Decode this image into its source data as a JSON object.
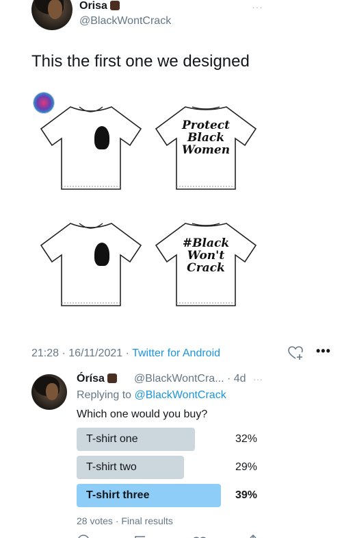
{
  "original_tweet": {
    "display_name": "Orisa",
    "handle": "@BlackWontCrack",
    "text": "This the first one we designed",
    "emoji_icon": "raised-fist-dark-skin",
    "more_glyph": "···"
  },
  "media": {
    "shirts": [
      {
        "view": "front",
        "print": "silhouette-woman"
      },
      {
        "view": "back",
        "caption_lines": [
          "Protect",
          "Black",
          "Women"
        ]
      },
      {
        "view": "front",
        "print": "silhouette-woman"
      },
      {
        "view": "back",
        "caption_lines": [
          "#Black",
          "Won't",
          "Crack"
        ]
      }
    ]
  },
  "tweet_footer": {
    "time": "21:28 · 16/11/2021 · ",
    "client": "Twitter for Android",
    "more_glyph": "•••"
  },
  "reply": {
    "display_name": "Órísa",
    "meta": "@BlackWontCra... · 4d",
    "more_glyph": "···",
    "replying_prefix": "Replying to ",
    "replying_handle": "@BlackWontCrack",
    "question": "Which one would you buy?"
  },
  "poll": {
    "options": [
      {
        "label": "T-shirt one",
        "percent_text": "32%",
        "percent": 32,
        "winner": false
      },
      {
        "label": "T-shirt two",
        "percent_text": "29%",
        "percent": 29,
        "winner": false
      },
      {
        "label": "T-shirt three",
        "percent_text": "39%",
        "percent": 39,
        "winner": true
      }
    ],
    "footer": "28 votes · Final results"
  },
  "colors": {
    "link": "#1b95e0",
    "muted": "#657786",
    "poll_bar": "#ccd6dd",
    "poll_winner": "#8ecdf8"
  }
}
